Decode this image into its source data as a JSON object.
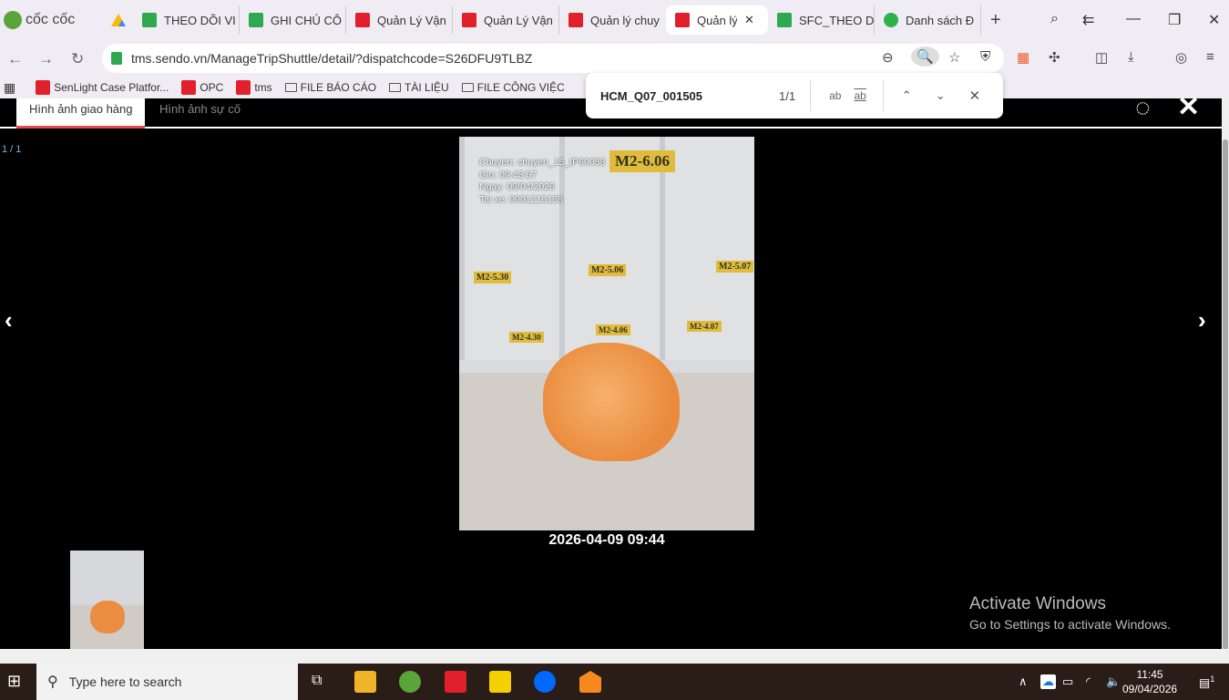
{
  "browser": {
    "brand": "cốc cốc",
    "tabs": [
      {
        "label": "THEO DÕI VI",
        "icon": "sheets"
      },
      {
        "label": "GHI CHÚ CÔ",
        "icon": "sheets"
      },
      {
        "label": "Quản Lý Vận",
        "icon": "sendo"
      },
      {
        "label": "Quản Lý Vận",
        "icon": "sendo"
      },
      {
        "label": "Quản lý chuy",
        "icon": "sendo"
      },
      {
        "label": "Quản lý",
        "icon": "sendo",
        "active": true
      },
      {
        "label": "SFC_THEO D",
        "icon": "sheets"
      },
      {
        "label": "Danh sách Đ",
        "icon": "sync"
      }
    ],
    "url": "tms.sendo.vn/ManageTripShuttle/detail/?dispatchcode=S26DFU9TLBZ",
    "bookmarks": [
      {
        "label": "SenLight Case Platfor...",
        "icon": "sendo"
      },
      {
        "label": "OPC",
        "icon": "sendo"
      },
      {
        "label": "tms",
        "icon": "sendo"
      },
      {
        "label": "FILE BÁO CÁO",
        "icon": "folder"
      },
      {
        "label": "TÀI LIỆU",
        "icon": "folder"
      },
      {
        "label": "FILE CÔNG VIỆC",
        "icon": "folder"
      }
    ],
    "find": {
      "query": "HCM_Q07_001505",
      "count": "1/1",
      "match_case": "ab",
      "whole_word": "ab"
    }
  },
  "page": {
    "tabs": [
      "Hình ảnh giao hàng",
      "Hình ảnh sự cố"
    ],
    "counter": "1 / 1",
    "photo_overlay": [
      "Chuyen: chuyen_15_IP60058",
      "Gio: 09:43:57",
      "Ngay: 09/04/2026",
      "Tai xe: 0901215158"
    ],
    "photo_labels": [
      "M2-6.06",
      "M2-5.30",
      "M2-5.06",
      "M2-5.07",
      "M2-4.30",
      "M2-4.06",
      "M2-4.07"
    ],
    "caption": "2026-04-09 09:44",
    "accent": "#e84a55"
  },
  "watermark": {
    "title": "Activate Windows",
    "subtitle": "Go to Settings to activate Windows."
  },
  "taskbar": {
    "search_placeholder": "Type here to search",
    "time": "11:45",
    "date": "09/04/2026",
    "notifications": "1"
  }
}
